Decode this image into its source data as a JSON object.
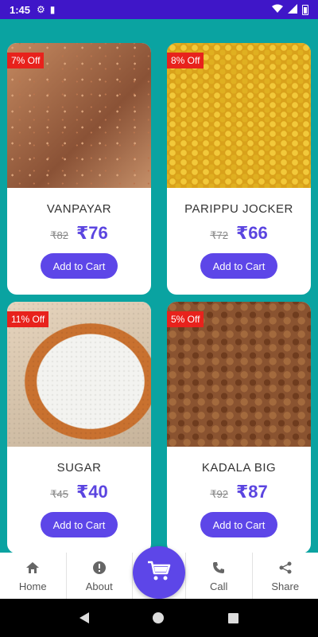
{
  "status_bar": {
    "time": "1:45"
  },
  "products": [
    {
      "badge": "7% Off",
      "name": "VANPAYAR",
      "old_price": "₹82",
      "price": "₹76",
      "button": "Add to Cart"
    },
    {
      "badge": "8% Off",
      "name": "PARIPPU JOCKER",
      "old_price": "₹72",
      "price": "₹66",
      "button": "Add to Cart"
    },
    {
      "badge": "11% Off",
      "name": "SUGAR",
      "old_price": "₹45",
      "price": "₹40",
      "button": "Add to Cart"
    },
    {
      "badge": "5% Off",
      "name": "KADALA BIG",
      "old_price": "₹92",
      "price": "₹87",
      "button": "Add to Cart"
    }
  ],
  "nav": {
    "home": "Home",
    "about": "About",
    "call": "Call",
    "share": "Share"
  },
  "colors": {
    "status_bar": "#3f16c8",
    "background": "#0aa3a1",
    "accent": "#5d46e8",
    "badge": "#e8221c"
  }
}
